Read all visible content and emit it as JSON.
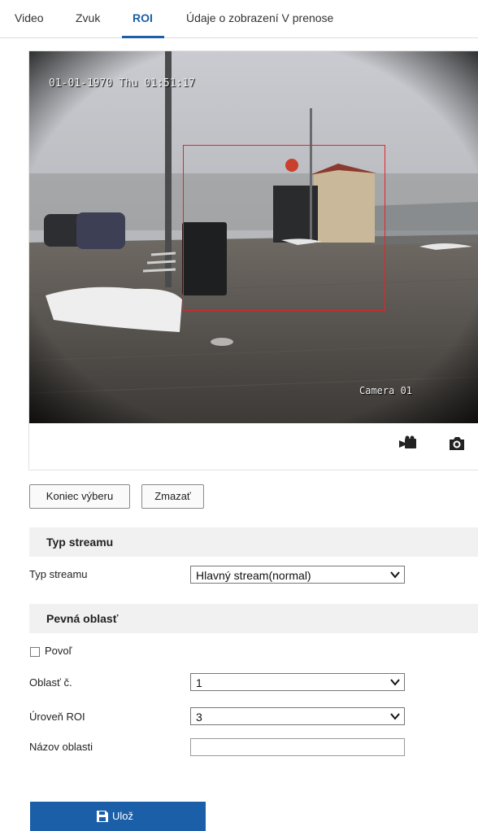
{
  "tabs": [
    {
      "label": "Video"
    },
    {
      "label": "Zvuk"
    },
    {
      "label": "ROI",
      "active": true
    },
    {
      "label": "Údaje o zobrazení V prenose"
    }
  ],
  "viewer": {
    "osd_timestamp": "01-01-1970 Thu 01:51:17",
    "osd_camera_name": "Camera 01",
    "roi_color": "#e2262a",
    "record_icon": "video-record-icon",
    "snapshot_icon": "camera-snapshot-icon"
  },
  "actions": {
    "end_selection_label": "Koniec výberu",
    "clear_label": "Zmazať"
  },
  "stream_section": {
    "title": "Typ streamu",
    "stream_type_label": "Typ streamu",
    "stream_type_value": "Hlavný stream(normal)"
  },
  "fixed_region_section": {
    "title": "Pevná oblasť",
    "enable_label": "Povoľ",
    "enable_checked": false,
    "region_no_label": "Oblasť č.",
    "region_no_value": "1",
    "roi_level_label": "Úroveň ROI",
    "roi_level_value": "3",
    "region_name_label": "Názov oblasti",
    "region_name_value": ""
  },
  "save": {
    "label": "Ulož",
    "color": "#1a5fa8"
  }
}
